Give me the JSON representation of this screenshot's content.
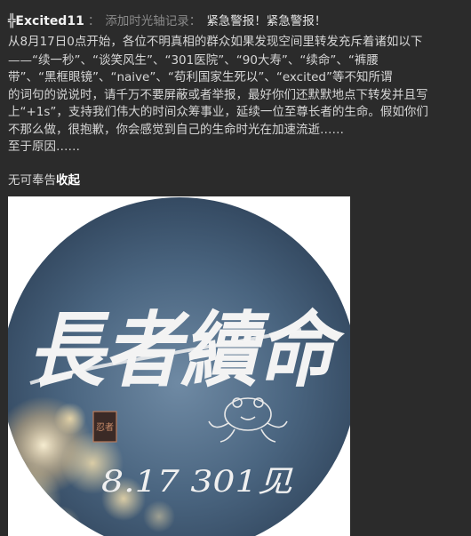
{
  "post": {
    "username": "╬Excited11",
    "separator": "：",
    "action": "添加时光轴记录：",
    "headline": "紧急警报！紧急警报！",
    "body_lines": [
      "从8月17日0点开始，各位不明真相的群众如果发现空间里转发充斥着诸如以下",
      "——“续一秒”、“谈笑风生”、“301医院”、“90大寿”、“续命”、“裤腰",
      "带”、“黑框眼镜”、“naive”、“苟利国家生死以”、“excited”等不知所谓",
      "的词句的说说时，请千万不要屏蔽或者举报，最好你们还默默地点下转发并且写",
      "上“+1s”，支持我们伟大的时间众筹事业，延续一位至尊长者的生命。假如你们",
      "不那么做，很抱歉，你会感觉到自己的生命时光在加速流逝……",
      "至于原因……"
    ],
    "footer_text": "无可奉告",
    "collapse_label": "收起"
  },
  "image": {
    "main_text": "長者續命",
    "bottom_text": "8.17 301见",
    "seal_text": "忍者",
    "frog_icon": "frog-icon"
  }
}
